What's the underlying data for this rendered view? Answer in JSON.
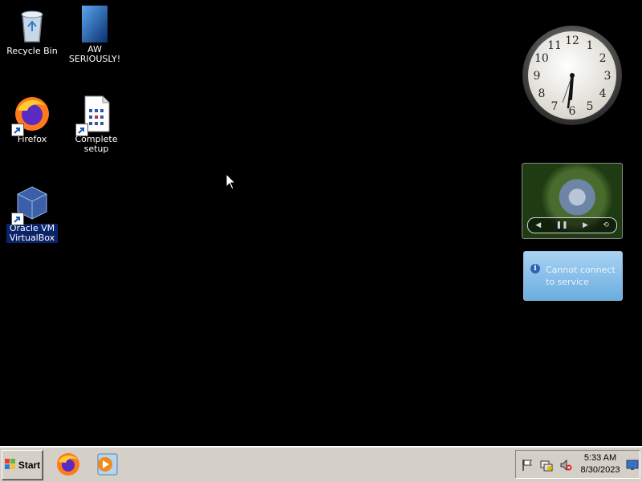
{
  "desktop_icons": [
    {
      "label": "Recycle Bin",
      "icon": "recycle-bin-icon"
    },
    {
      "label": "AW SERIOUSLY!",
      "icon": "image-file-icon"
    },
    {
      "label": "Firefox",
      "icon": "firefox-icon"
    },
    {
      "label": "Complete setup",
      "icon": "setup-file-icon"
    },
    {
      "label": "Oracle VM VirtualBox",
      "icon": "virtualbox-icon"
    }
  ],
  "gadgets": {
    "clock": {
      "numerals": [
        "12",
        "1",
        "2",
        "3",
        "4",
        "5",
        "6",
        "7",
        "8",
        "9",
        "10",
        "11"
      ]
    },
    "weather": {
      "message": "Cannot connect to service"
    }
  },
  "taskbar": {
    "start_label": "Start",
    "quick_launch": [
      "firefox-icon",
      "media-player-icon"
    ],
    "tray": {
      "icons": [
        "flag-icon",
        "network-icon",
        "volume-muted-icon",
        "show-desktop-icon"
      ],
      "time": "5:33 AM",
      "date": "8/30/2023"
    }
  },
  "colors": {
    "desktop": "#000000",
    "taskbar": "#d4d0c8",
    "selection": "#0a246a"
  }
}
